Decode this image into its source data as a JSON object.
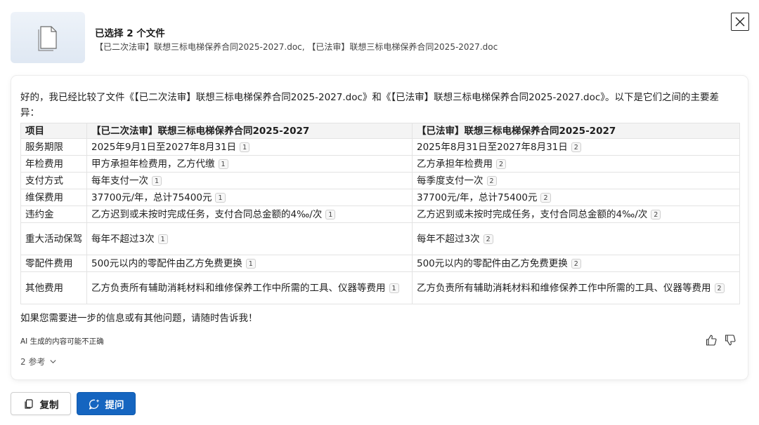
{
  "header": {
    "title": "已选择 2 个文件",
    "files": "【已二次法审】联想三标电梯保养合同2025-2027.doc, 【已法审】联想三标电梯保养合同2025-2027.doc"
  },
  "response": {
    "intro": "好的，我已经比较了文件《【已二次法审】联想三标电梯保养合同2025-2027.doc》和《【已法审】联想三标电梯保养合同2025-2027.doc》。以下是它们之间的主要差异：",
    "table": {
      "headers": [
        "项目",
        "【已二次法审】联想三标电梯保养合同2025-2027",
        "【已法审】联想三标电梯保养合同2025-2027"
      ],
      "rows": [
        {
          "item": "服务期限",
          "a": "2025年9月1日至2027年8月31日",
          "a_cite": "1",
          "b": "2025年8月31日至2027年8月31日",
          "b_cite": "2"
        },
        {
          "item": "年检费用",
          "a": "甲方承担年检费用，乙方代缴",
          "a_cite": "1",
          "b": "乙方承担年检费用",
          "b_cite": "2"
        },
        {
          "item": "支付方式",
          "a": "每年支付一次",
          "a_cite": "1",
          "b": "每季度支付一次",
          "b_cite": "2"
        },
        {
          "item": "维保费用",
          "a": "37700元/年，总计75400元",
          "a_cite": "1",
          "b": "37700元/年，总计75400元",
          "b_cite": "2"
        },
        {
          "item": "违约金",
          "a": "乙方迟到或未按时完成任务，支付合同总金额的4‰/次",
          "a_cite": "1",
          "b": "乙方迟到或未按时完成任务，支付合同总金额的4‰/次",
          "b_cite": "2"
        },
        {
          "item": "重大活动保驾",
          "a": "每年不超过3次",
          "a_cite": "1",
          "b": "每年不超过3次",
          "b_cite": "2"
        },
        {
          "item": "零配件费用",
          "a": "500元以内的零配件由乙方免费更换",
          "a_cite": "1",
          "b": "500元以内的零配件由乙方免费更换",
          "b_cite": "2"
        },
        {
          "item": "其他费用",
          "a": "乙方负责所有辅助消耗材料和维修保养工作中所需的工具、仪器等费用",
          "a_cite": "1",
          "b": "乙方负责所有辅助消耗材料和维修保养工作中所需的工具、仪器等费用",
          "b_cite": "2"
        }
      ]
    },
    "outro": "如果您需要进一步的信息或有其他问题，请随时告诉我！",
    "disclaimer": "AI 生成的内容可能不正确",
    "references_label": "2 参考"
  },
  "actions": {
    "copy_label": "复制",
    "ask_label": "提问"
  },
  "colors": {
    "accent": "#1565c0",
    "thumbnail_bg": "#e6edf6",
    "table_header_bg": "#f4f4f4"
  }
}
